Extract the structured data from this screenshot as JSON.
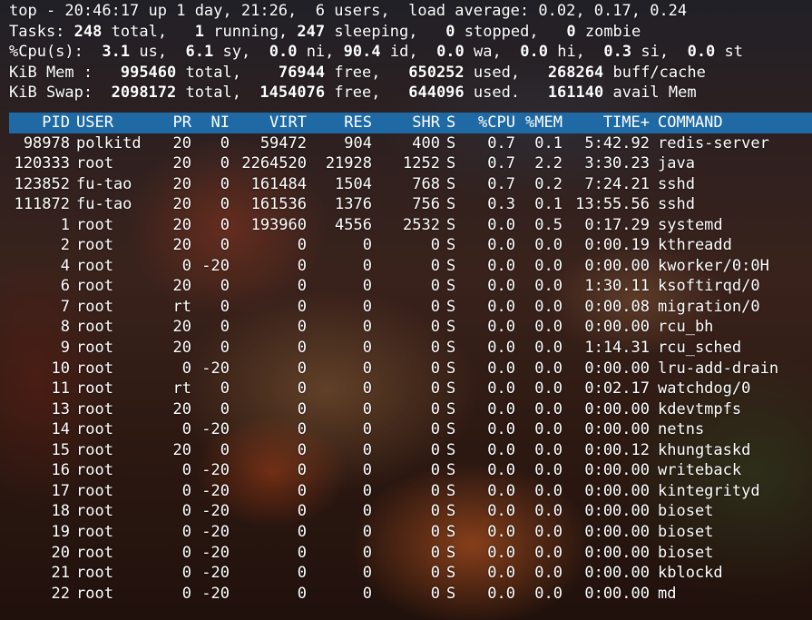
{
  "summary": {
    "line1": "top - 20:46:17 up 1 day, 21:26,  6 users,  load average: 0.02, 0.17, 0.24",
    "tasks": {
      "label": "Tasks:",
      "total": "248",
      "total_label": "total,",
      "running": "1",
      "running_label": "running,",
      "sleeping": "247",
      "sleeping_label": "sleeping,",
      "stopped": "0",
      "stopped_label": "stopped,",
      "zombie": "0",
      "zombie_label": "zombie"
    },
    "cpu": {
      "label": "%Cpu(s):",
      "us": "3.1",
      "us_label": "us,",
      "sy": "6.1",
      "sy_label": "sy,",
      "ni": "0.0",
      "ni_label": "ni,",
      "id": "90.4",
      "id_label": "id,",
      "wa": "0.0",
      "wa_label": "wa,",
      "hi": "0.0",
      "hi_label": "hi,",
      "si": "0.3",
      "si_label": "si,",
      "st": "0.0",
      "st_label": "st"
    },
    "mem": {
      "label": "KiB Mem :",
      "total": "995460",
      "total_label": "total,",
      "free": "76944",
      "free_label": "free,",
      "used": "650252",
      "used_label": "used,",
      "buff": "268264",
      "buff_label": "buff/cache"
    },
    "swap": {
      "label": "KiB Swap:",
      "total": "2098172",
      "total_label": "total,",
      "free": "1454076",
      "free_label": "free,",
      "used": "644096",
      "used_label": "used.",
      "avail": "161140",
      "avail_label": "avail Mem"
    }
  },
  "columns": {
    "pid": "PID",
    "user": "USER",
    "pr": "PR",
    "ni": "NI",
    "virt": "VIRT",
    "res": "RES",
    "shr": "SHR",
    "s": "S",
    "cpu": "%CPU",
    "mem": "%MEM",
    "time": "TIME+",
    "command": "COMMAND"
  },
  "processes": [
    {
      "pid": "98978",
      "user": "polkitd",
      "pr": "20",
      "ni": "0",
      "virt": "59472",
      "res": "904",
      "shr": "400",
      "s": "S",
      "cpu": "0.7",
      "mem": "0.1",
      "time": "5:42.92",
      "command": "redis-server"
    },
    {
      "pid": "120333",
      "user": "root",
      "pr": "20",
      "ni": "0",
      "virt": "2264520",
      "res": "21928",
      "shr": "1252",
      "s": "S",
      "cpu": "0.7",
      "mem": "2.2",
      "time": "3:30.23",
      "command": "java"
    },
    {
      "pid": "123852",
      "user": "fu-tao",
      "pr": "20",
      "ni": "0",
      "virt": "161484",
      "res": "1504",
      "shr": "768",
      "s": "S",
      "cpu": "0.7",
      "mem": "0.2",
      "time": "7:24.21",
      "command": "sshd"
    },
    {
      "pid": "111872",
      "user": "fu-tao",
      "pr": "20",
      "ni": "0",
      "virt": "161536",
      "res": "1376",
      "shr": "756",
      "s": "S",
      "cpu": "0.3",
      "mem": "0.1",
      "time": "13:55.56",
      "command": "sshd"
    },
    {
      "pid": "1",
      "user": "root",
      "pr": "20",
      "ni": "0",
      "virt": "193960",
      "res": "4556",
      "shr": "2532",
      "s": "S",
      "cpu": "0.0",
      "mem": "0.5",
      "time": "0:17.29",
      "command": "systemd"
    },
    {
      "pid": "2",
      "user": "root",
      "pr": "20",
      "ni": "0",
      "virt": "0",
      "res": "0",
      "shr": "0",
      "s": "S",
      "cpu": "0.0",
      "mem": "0.0",
      "time": "0:00.19",
      "command": "kthreadd"
    },
    {
      "pid": "4",
      "user": "root",
      "pr": "0",
      "ni": "-20",
      "virt": "0",
      "res": "0",
      "shr": "0",
      "s": "S",
      "cpu": "0.0",
      "mem": "0.0",
      "time": "0:00.00",
      "command": "kworker/0:0H"
    },
    {
      "pid": "6",
      "user": "root",
      "pr": "20",
      "ni": "0",
      "virt": "0",
      "res": "0",
      "shr": "0",
      "s": "S",
      "cpu": "0.0",
      "mem": "0.0",
      "time": "1:30.11",
      "command": "ksoftirqd/0"
    },
    {
      "pid": "7",
      "user": "root",
      "pr": "rt",
      "ni": "0",
      "virt": "0",
      "res": "0",
      "shr": "0",
      "s": "S",
      "cpu": "0.0",
      "mem": "0.0",
      "time": "0:00.08",
      "command": "migration/0"
    },
    {
      "pid": "8",
      "user": "root",
      "pr": "20",
      "ni": "0",
      "virt": "0",
      "res": "0",
      "shr": "0",
      "s": "S",
      "cpu": "0.0",
      "mem": "0.0",
      "time": "0:00.00",
      "command": "rcu_bh"
    },
    {
      "pid": "9",
      "user": "root",
      "pr": "20",
      "ni": "0",
      "virt": "0",
      "res": "0",
      "shr": "0",
      "s": "S",
      "cpu": "0.0",
      "mem": "0.0",
      "time": "1:14.31",
      "command": "rcu_sched"
    },
    {
      "pid": "10",
      "user": "root",
      "pr": "0",
      "ni": "-20",
      "virt": "0",
      "res": "0",
      "shr": "0",
      "s": "S",
      "cpu": "0.0",
      "mem": "0.0",
      "time": "0:00.00",
      "command": "lru-add-drain"
    },
    {
      "pid": "11",
      "user": "root",
      "pr": "rt",
      "ni": "0",
      "virt": "0",
      "res": "0",
      "shr": "0",
      "s": "S",
      "cpu": "0.0",
      "mem": "0.0",
      "time": "0:02.17",
      "command": "watchdog/0"
    },
    {
      "pid": "13",
      "user": "root",
      "pr": "20",
      "ni": "0",
      "virt": "0",
      "res": "0",
      "shr": "0",
      "s": "S",
      "cpu": "0.0",
      "mem": "0.0",
      "time": "0:00.00",
      "command": "kdevtmpfs"
    },
    {
      "pid": "14",
      "user": "root",
      "pr": "0",
      "ni": "-20",
      "virt": "0",
      "res": "0",
      "shr": "0",
      "s": "S",
      "cpu": "0.0",
      "mem": "0.0",
      "time": "0:00.00",
      "command": "netns"
    },
    {
      "pid": "15",
      "user": "root",
      "pr": "20",
      "ni": "0",
      "virt": "0",
      "res": "0",
      "shr": "0",
      "s": "S",
      "cpu": "0.0",
      "mem": "0.0",
      "time": "0:00.12",
      "command": "khungtaskd"
    },
    {
      "pid": "16",
      "user": "root",
      "pr": "0",
      "ni": "-20",
      "virt": "0",
      "res": "0",
      "shr": "0",
      "s": "S",
      "cpu": "0.0",
      "mem": "0.0",
      "time": "0:00.00",
      "command": "writeback"
    },
    {
      "pid": "17",
      "user": "root",
      "pr": "0",
      "ni": "-20",
      "virt": "0",
      "res": "0",
      "shr": "0",
      "s": "S",
      "cpu": "0.0",
      "mem": "0.0",
      "time": "0:00.00",
      "command": "kintegrityd"
    },
    {
      "pid": "18",
      "user": "root",
      "pr": "0",
      "ni": "-20",
      "virt": "0",
      "res": "0",
      "shr": "0",
      "s": "S",
      "cpu": "0.0",
      "mem": "0.0",
      "time": "0:00.00",
      "command": "bioset"
    },
    {
      "pid": "19",
      "user": "root",
      "pr": "0",
      "ni": "-20",
      "virt": "0",
      "res": "0",
      "shr": "0",
      "s": "S",
      "cpu": "0.0",
      "mem": "0.0",
      "time": "0:00.00",
      "command": "bioset"
    },
    {
      "pid": "20",
      "user": "root",
      "pr": "0",
      "ni": "-20",
      "virt": "0",
      "res": "0",
      "shr": "0",
      "s": "S",
      "cpu": "0.0",
      "mem": "0.0",
      "time": "0:00.00",
      "command": "bioset"
    },
    {
      "pid": "21",
      "user": "root",
      "pr": "0",
      "ni": "-20",
      "virt": "0",
      "res": "0",
      "shr": "0",
      "s": "S",
      "cpu": "0.0",
      "mem": "0.0",
      "time": "0:00.00",
      "command": "kblockd"
    },
    {
      "pid": "22",
      "user": "root",
      "pr": "0",
      "ni": "-20",
      "virt": "0",
      "res": "0",
      "shr": "0",
      "s": "S",
      "cpu": "0.0",
      "mem": "0.0",
      "time": "0:00.00",
      "command": "md"
    }
  ],
  "colors": {
    "header_bar": "#1f6aa5",
    "text": "#ffffff"
  }
}
